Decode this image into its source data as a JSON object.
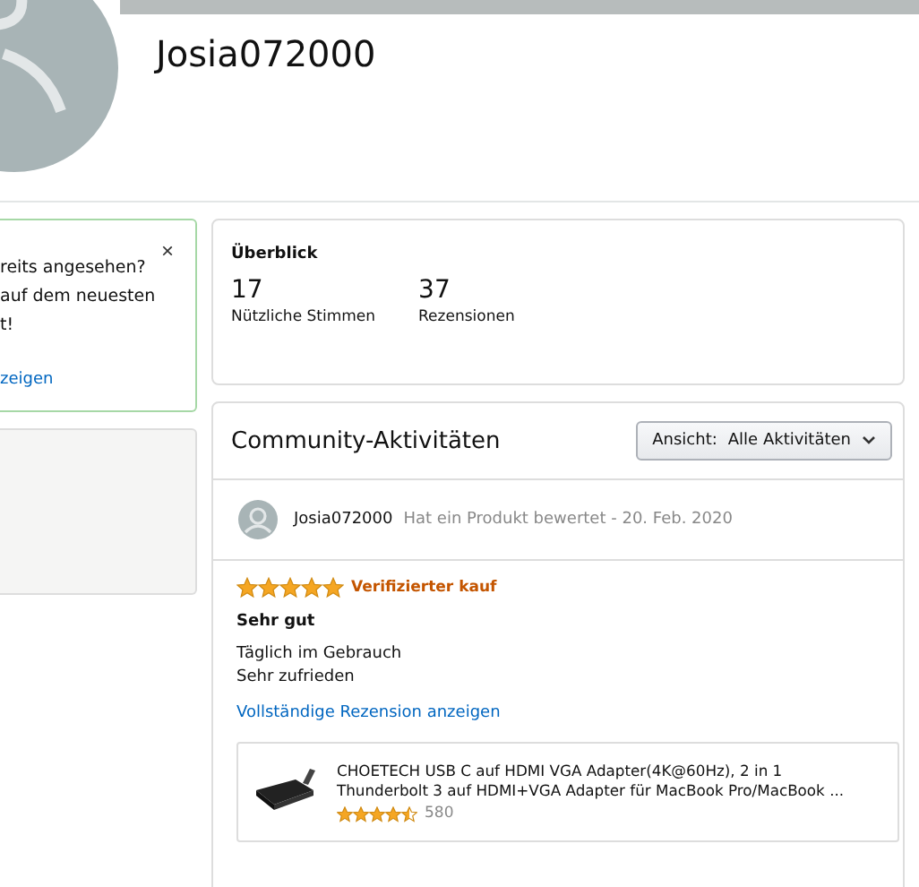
{
  "profile": {
    "name": "Josia072000"
  },
  "notice": {
    "close": "×",
    "lines": [
      "reits angesehen?",
      "auf dem neuesten",
      "t!"
    ],
    "link": "zeigen"
  },
  "overview": {
    "title": "Überblick",
    "stats": [
      {
        "value": "17",
        "label": "Nützliche Stimmen"
      },
      {
        "value": "37",
        "label": "Rezensionen"
      }
    ]
  },
  "community": {
    "title": "Community-Aktivitäten",
    "filter": {
      "label": "Ansicht:",
      "value": "Alle Aktivitäten"
    },
    "activity": {
      "user": "Josia072000",
      "action": "Hat ein Produkt bewertet - 20. Feb. 2020",
      "stars": 5,
      "badge": "Verifizierter kauf",
      "headline": "Sehr gut",
      "body": [
        "Täglich im Gebrauch",
        "Sehr zufrieden"
      ],
      "link": "Vollständige Rezension anzeigen",
      "product": {
        "title_lines": [
          "CHOETECH USB C auf HDMI VGA Adapter(4K@60Hz), 2 in 1",
          "Thunderbolt 3 auf HDMI+VGA Adapter für MacBook Pro/MacBook ..."
        ],
        "stars": 4.5,
        "count": "580"
      }
    }
  }
}
